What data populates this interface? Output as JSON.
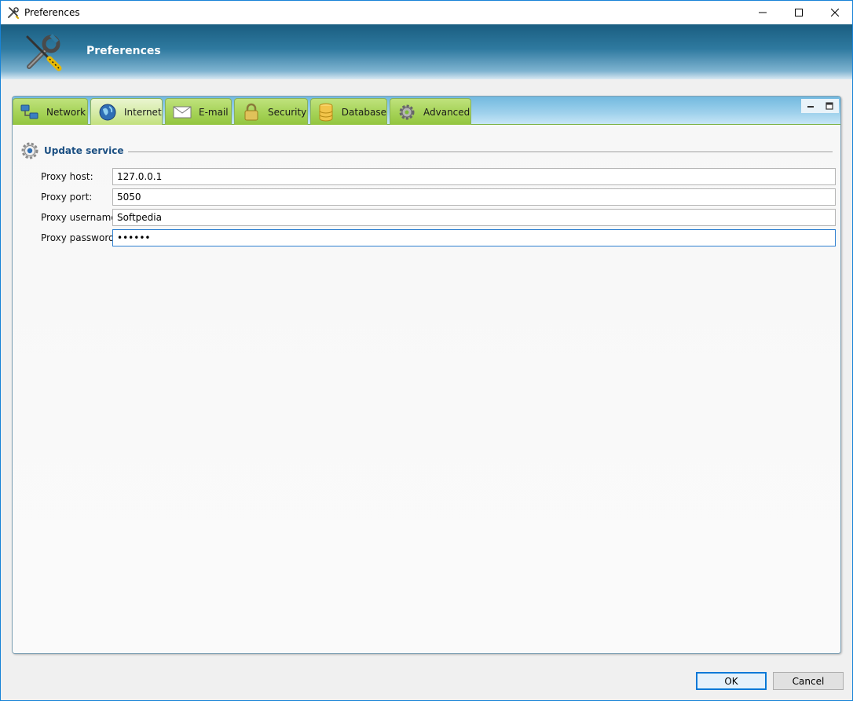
{
  "window": {
    "title": "Preferences",
    "icon": "tools-icon"
  },
  "banner": {
    "title": "Preferences",
    "icon": "wrench-screwdriver-icon"
  },
  "tabs": [
    {
      "label": "Network",
      "icon": "network-icon",
      "active": false
    },
    {
      "label": "Internet",
      "icon": "globe-icon",
      "active": true
    },
    {
      "label": "E-mail",
      "icon": "envelope-icon",
      "active": false
    },
    {
      "label": "Security",
      "icon": "lock-icon",
      "active": false
    },
    {
      "label": "Database",
      "icon": "database-icon",
      "active": false
    },
    {
      "label": "Advanced",
      "icon": "gear-icon",
      "active": false
    }
  ],
  "group": {
    "title": "Update service",
    "icon": "gear-icon"
  },
  "fields": [
    {
      "label": "Proxy host:",
      "value": "127.0.0.1",
      "type": "text"
    },
    {
      "label": "Proxy port:",
      "value": "5050",
      "type": "text"
    },
    {
      "label": "Proxy username:",
      "value": "Softpedia",
      "type": "text"
    },
    {
      "label": "Proxy password:",
      "value": "softpe",
      "type": "password"
    }
  ],
  "buttons": {
    "ok": "OK",
    "cancel": "Cancel"
  },
  "colors": {
    "accent": "#1883d7",
    "tab_green": "#a5d257",
    "group_title": "#1b4f82",
    "banner_blue": "#2f7aa0"
  }
}
